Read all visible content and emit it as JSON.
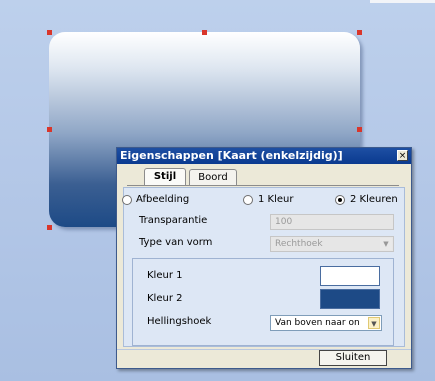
{
  "dialog": {
    "title": "Eigenschappen [Kaart (enkelzijdig)]",
    "close_glyph": "×"
  },
  "tabs": [
    {
      "label": "Stijl",
      "active": true
    },
    {
      "label": "Boord",
      "active": false
    }
  ],
  "fill_mode": {
    "options": [
      {
        "label": "Afbeelding",
        "checked": false
      },
      {
        "label": "1 Kleur",
        "checked": false
      },
      {
        "label": "2 Kleuren",
        "checked": true
      }
    ]
  },
  "transparency": {
    "label": "Transparantie",
    "value": "100"
  },
  "shape_type": {
    "label": "Type van vorm",
    "value": "Rechthoek"
  },
  "gradient": {
    "color1_label": "Kleur 1",
    "color1": "#ffffff",
    "color2_label": "Kleur 2",
    "color2": "#1d4a86",
    "angle_label": "Hellingshoek",
    "angle_value": "Van boven naar on"
  },
  "close_button": {
    "label": "Sluiten"
  },
  "colors": {
    "titlebar": "#0a3a8f",
    "panel": "#dde7f5",
    "selection_handle": "#d9362b"
  }
}
